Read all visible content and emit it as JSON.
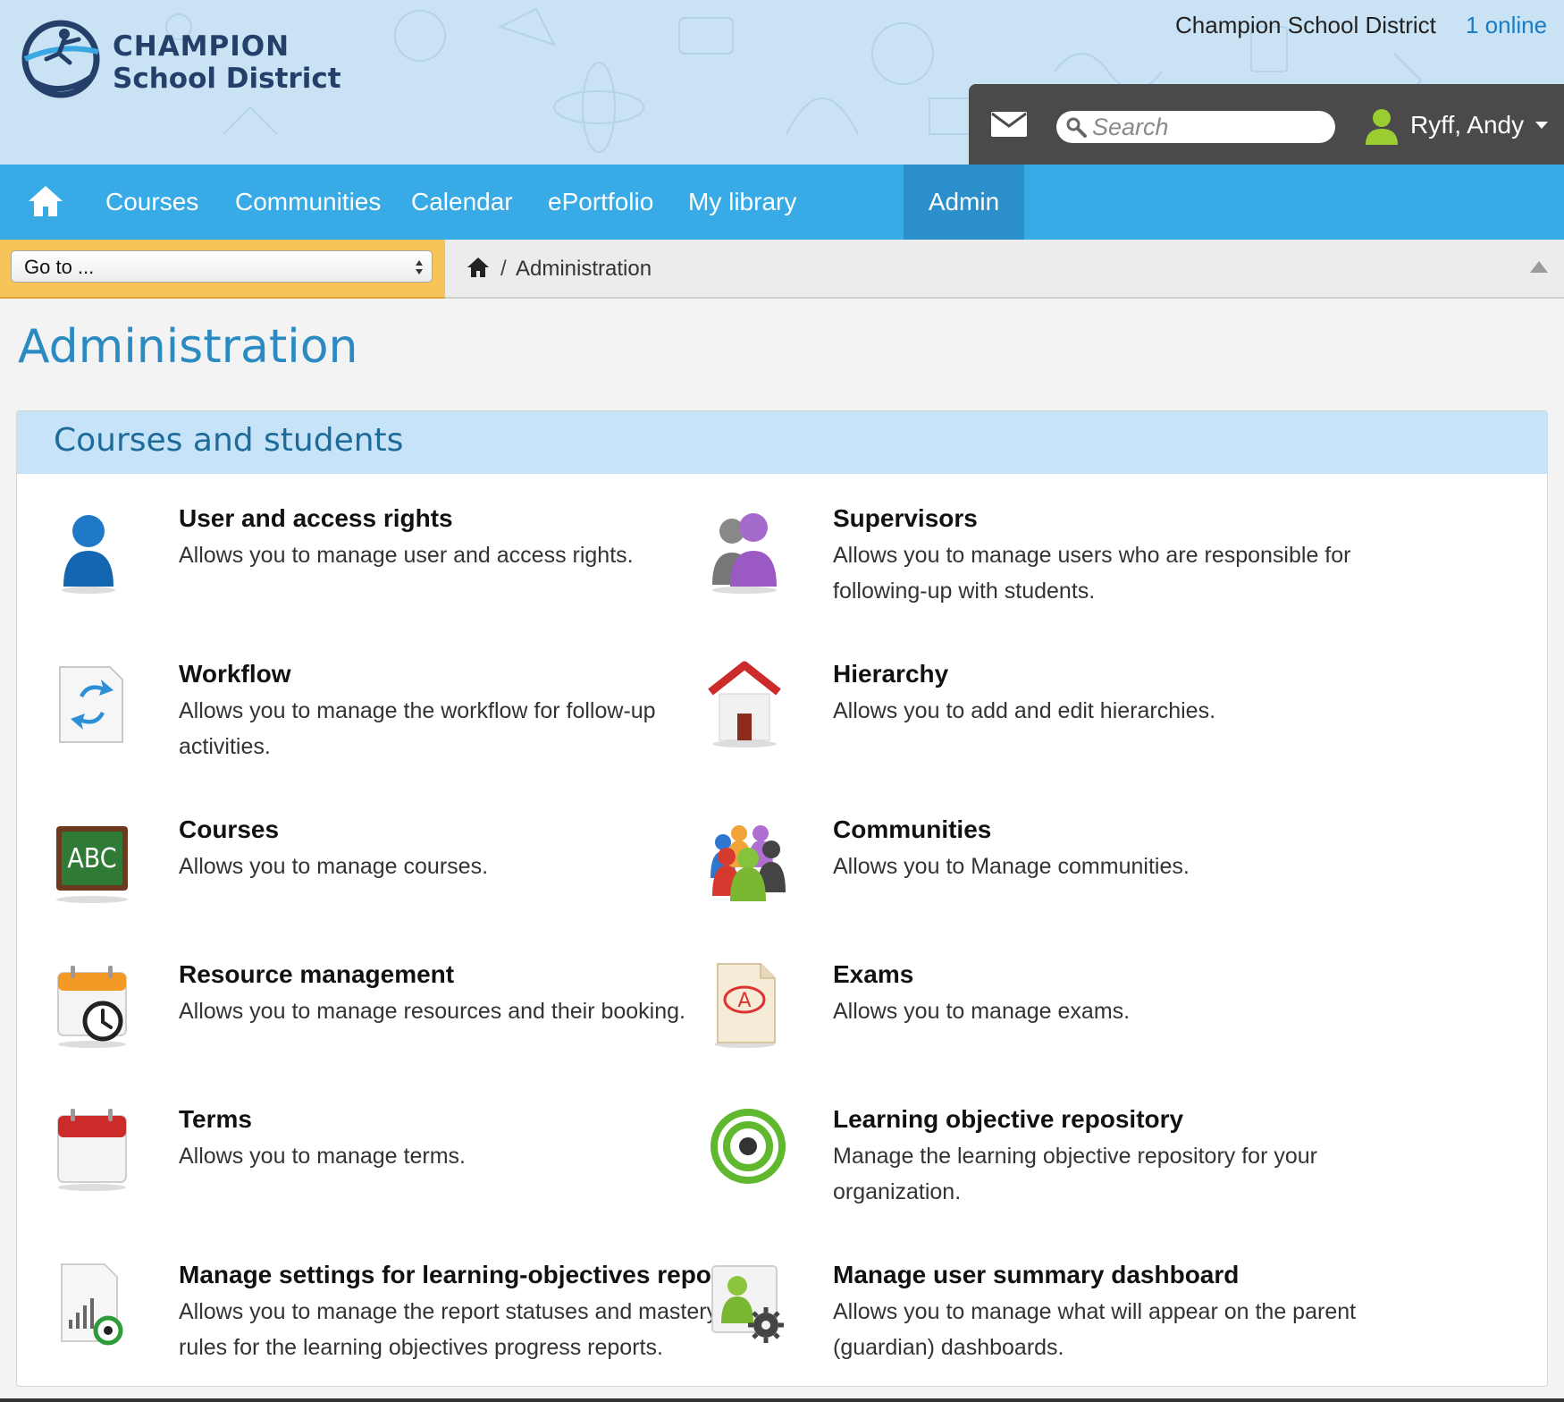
{
  "header": {
    "logo": {
      "line1": "CHAMPION",
      "line2": "School District"
    },
    "district_name": "Champion School District",
    "online_label": "1 online",
    "search": {
      "placeholder": "Search"
    },
    "user": {
      "name": "Ryff, Andy"
    }
  },
  "nav": {
    "items": [
      {
        "label": "Courses"
      },
      {
        "label": "Communities"
      },
      {
        "label": "Calendar"
      },
      {
        "label": "ePortfolio"
      },
      {
        "label": "My library"
      },
      {
        "label": "Admin",
        "active": true
      }
    ]
  },
  "toolbar": {
    "goto_label": "Go to ...",
    "breadcrumb": {
      "separator": "/",
      "current": "Administration"
    }
  },
  "page": {
    "title": "Administration",
    "section": {
      "title": "Courses and students",
      "items": [
        {
          "title": "User and access rights",
          "description": "Allows you to manage user and access rights.",
          "icon": "user-icon"
        },
        {
          "title": "Supervisors",
          "description": "Allows you to manage users who are responsible for following-up with students.",
          "icon": "supervisors-icon"
        },
        {
          "title": "Workflow",
          "description": "Allows you to manage the workflow for follow-up activities.",
          "icon": "workflow-icon"
        },
        {
          "title": "Hierarchy",
          "description": "Allows you to add and edit hierarchies.",
          "icon": "house-icon"
        },
        {
          "title": "Courses",
          "description": "Allows you to manage courses.",
          "icon": "chalkboard-abc-icon"
        },
        {
          "title": "Communities",
          "description": "Allows you to Manage communities.",
          "icon": "group-icon"
        },
        {
          "title": "Resource management",
          "description": "Allows you to manage resources and their booking.",
          "icon": "calendar-clock-icon"
        },
        {
          "title": "Exams",
          "description": "Allows you to manage exams.",
          "icon": "exam-paper-icon"
        },
        {
          "title": "Terms",
          "description": "Allows you to manage terms.",
          "icon": "calendar-icon"
        },
        {
          "title": "Learning objective repository",
          "description": "Manage the learning objective repository for your organization.",
          "icon": "target-icon"
        },
        {
          "title": "Manage settings for learning-objectives reports",
          "description": "Allows you to manage the report statuses and mastery rules for the learning objectives progress reports.",
          "icon": "report-chart-icon"
        },
        {
          "title": "Manage user summary dashboard",
          "description": "Allows you to manage what will appear on the parent (guardian) dashboards.",
          "icon": "user-settings-icon"
        }
      ]
    }
  },
  "colors": {
    "header_bg": "#c9e2f4",
    "nav_bg": "#38aae6",
    "nav_active_bg": "#2a8fcb",
    "goto_bg": "#f7c45a",
    "title_blue": "#2c8ac2",
    "panel_header_bg": "#c7e3f7",
    "link_blue": "#1a7cc4"
  }
}
